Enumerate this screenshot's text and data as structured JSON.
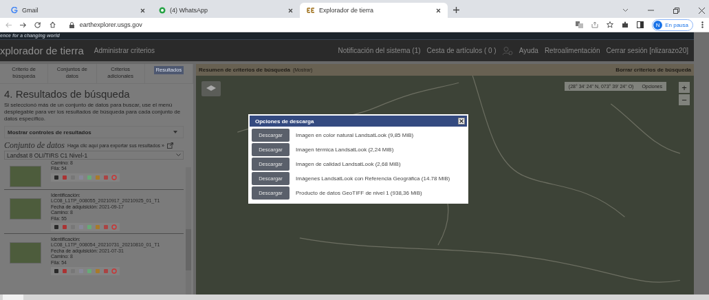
{
  "browser": {
    "tabs": [
      {
        "title": "Gmail",
        "selected": false
      },
      {
        "title": "(4) WhatsApp",
        "selected": false
      },
      {
        "title": "Explorador de tierra",
        "selected": true
      }
    ],
    "url": "earthexplorer.usgs.gov",
    "profile": {
      "initial": "N",
      "label": "En pausa"
    }
  },
  "site": {
    "tagline": "ence for a changing world",
    "title": "xplorador de tierra",
    "manage": "Administrar criterios",
    "nav": [
      {
        "label": "Notificación del sistema (1)",
        "kind": "link"
      },
      {
        "label": "Cesta de artículos ( 0 )",
        "kind": "link"
      },
      {
        "kind": "user"
      },
      {
        "label": "Ayuda",
        "kind": "link"
      },
      {
        "label": "Retroalimentación",
        "kind": "link"
      },
      {
        "label": "Cerrar sesión [nlizarazo20]",
        "kind": "link"
      }
    ]
  },
  "left": {
    "tabs": [
      {
        "label": "Criterio de búsqueda",
        "selected": false
      },
      {
        "label": "Conjuntos de datos",
        "selected": false
      },
      {
        "label": "Criterios adicionales",
        "selected": false
      },
      {
        "label": "Resultados",
        "selected": true
      }
    ],
    "heading": "4. Resultados de búsqueda",
    "intro": "Si seleccionó más de un conjunto de datos para buscar, use el menú desplegable para ver los resultados de búsqueda para cada conjunto de datos específico.",
    "controls_toggle": "Mostrar controles de resultados",
    "dataset_title": "Conjunto de datos",
    "export_link": "Haga clic aquí para exportar sus resultados »",
    "dataset_select": "Landsat 8 OLI/TIRS C1 Nivel-1",
    "results": [
      {
        "fields": [
          {
            "label": "Camino:",
            "value": "8",
            "kind": "inline"
          },
          {
            "label": "Fila:",
            "value": "54",
            "kind": "inline"
          }
        ]
      },
      {
        "fields": [
          {
            "label": "Identificación:",
            "value": "LC08_L1TP_008055_20210917_20210925_01_T1",
            "kind": "stacked"
          },
          {
            "label": "Fecha de adquisición:",
            "value": "2021-09-17",
            "kind": "inline"
          },
          {
            "label": "Camino:",
            "value": "8",
            "kind": "inline"
          },
          {
            "label": "Fila:",
            "value": "55",
            "kind": "inline"
          }
        ]
      },
      {
        "fields": [
          {
            "label": "Identificación:",
            "value": "LC08_L1TP_008054_20210731_20210810_01_T1",
            "kind": "stacked"
          },
          {
            "label": "Fecha de adquisición:",
            "value": "2021-07-31",
            "kind": "inline"
          },
          {
            "label": "Camino:",
            "value": "8",
            "kind": "inline"
          },
          {
            "label": "Fila:",
            "value": "54",
            "kind": "inline"
          }
        ]
      }
    ]
  },
  "map": {
    "summary": "Resumen de criterios de búsqueda",
    "summary_toggle": "(Mostrar)",
    "clear": "Borrar criterios de búsqueda",
    "coords": "(28° 34' 24\" N, 073° 39' 24\" O)",
    "options": "Opciones",
    "zoom_in": "+",
    "zoom_out": "−"
  },
  "dialog": {
    "title": "Opciones de descarga",
    "items": [
      {
        "button": "Descargar",
        "label": "Imagen en color natural LandsatLook (9,85 MiB)"
      },
      {
        "button": "Descargar",
        "label": "Imagen térmica LandsatLook (2,24 MiB)"
      },
      {
        "button": "Descargar",
        "label": "Imagen de calidad LandsatLook (2,68 MiB)"
      },
      {
        "button": "Descargar",
        "label": "Imágenes LandsatLook con Referencia Geográfica (14.78 MiB)"
      },
      {
        "button": "Descargar",
        "label": "Producto de datos GeoTIFF de nivel 1 (938,36 MiB)"
      }
    ]
  }
}
